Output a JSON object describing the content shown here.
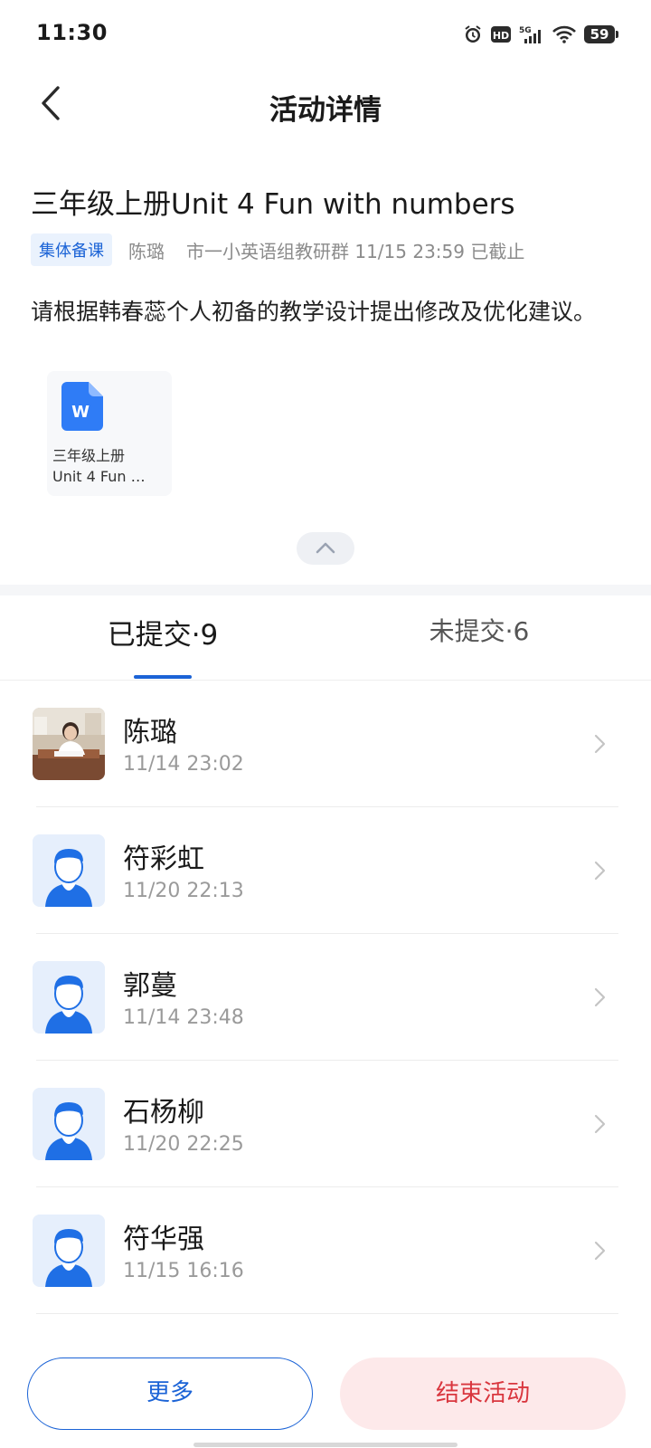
{
  "status_bar": {
    "time": "11:30",
    "icons": [
      "alarm-icon",
      "hd-icon",
      "signal-5g-icon",
      "wifi-icon"
    ],
    "battery": "59"
  },
  "nav": {
    "title": "活动详情",
    "back_icon": "back-arrow-icon"
  },
  "activity": {
    "title": "三年级上册Unit 4 Fun with numbers",
    "type_tag": "集体备课",
    "author": "陈璐",
    "meta": "市一小英语组教研群 11/15 23:59 已截止",
    "description": "请根据韩春蕊个人初备的教学设计提出修改及优化建议。",
    "attachment": {
      "icon": "word-document-icon",
      "icon_letter": "W",
      "name_line1": "三年级上册",
      "name_line2": "Unit 4 Fun …"
    }
  },
  "tabs": {
    "submitted": "已提交·9",
    "unsubmitted": "未提交·6"
  },
  "submissions": [
    {
      "name": "陈璐",
      "time": "11/14 23:02",
      "avatar": "photo"
    },
    {
      "name": "符彩虹",
      "time": "11/20 22:13",
      "avatar": "default-person"
    },
    {
      "name": "郭蔓",
      "time": "11/14 23:48",
      "avatar": "default-person"
    },
    {
      "name": "石杨柳",
      "time": "11/20 22:25",
      "avatar": "default-person"
    },
    {
      "name": "符华强",
      "time": "11/15 16:16",
      "avatar": "default-person"
    }
  ],
  "buttons": {
    "more": "更多",
    "end": "结束活动"
  },
  "colors": {
    "accent": "#1b63d6",
    "danger": "#d9363e",
    "danger_bg": "#fde9ea",
    "tag_bg": "#eaf2fd"
  }
}
